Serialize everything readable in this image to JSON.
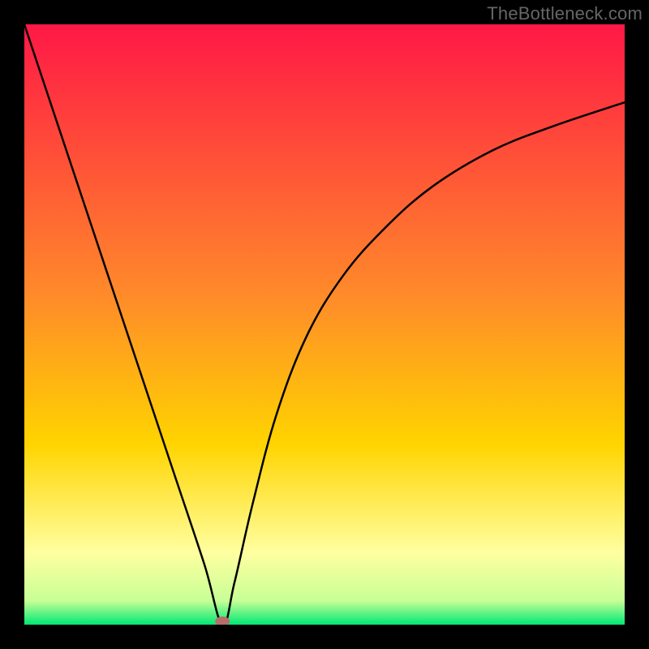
{
  "watermark": "TheBottleneck.com",
  "chart_data": {
    "type": "line",
    "title": "",
    "xlabel": "",
    "ylabel": "",
    "xlim": [
      0,
      100
    ],
    "ylim": [
      0,
      100
    ],
    "colors": {
      "frame": "#000000",
      "curve": "#000000",
      "marker": "#b86d6b",
      "gradient_top": "#ff1846",
      "gradient_mid": "#ffd400",
      "gradient_low": "#ffffa0",
      "gradient_bottom": "#00e874"
    },
    "marker": {
      "x": 33,
      "y": 0
    },
    "series": [
      {
        "name": "bottleneck-curve",
        "x": [
          0,
          5,
          10,
          15,
          20,
          25,
          30,
          33,
          35,
          38,
          42,
          47,
          53,
          60,
          68,
          78,
          88,
          100
        ],
        "y": [
          100,
          85,
          70,
          55,
          40,
          25,
          10,
          0,
          7,
          20,
          35,
          48,
          58,
          66,
          73,
          79,
          83,
          87
        ]
      }
    ]
  }
}
